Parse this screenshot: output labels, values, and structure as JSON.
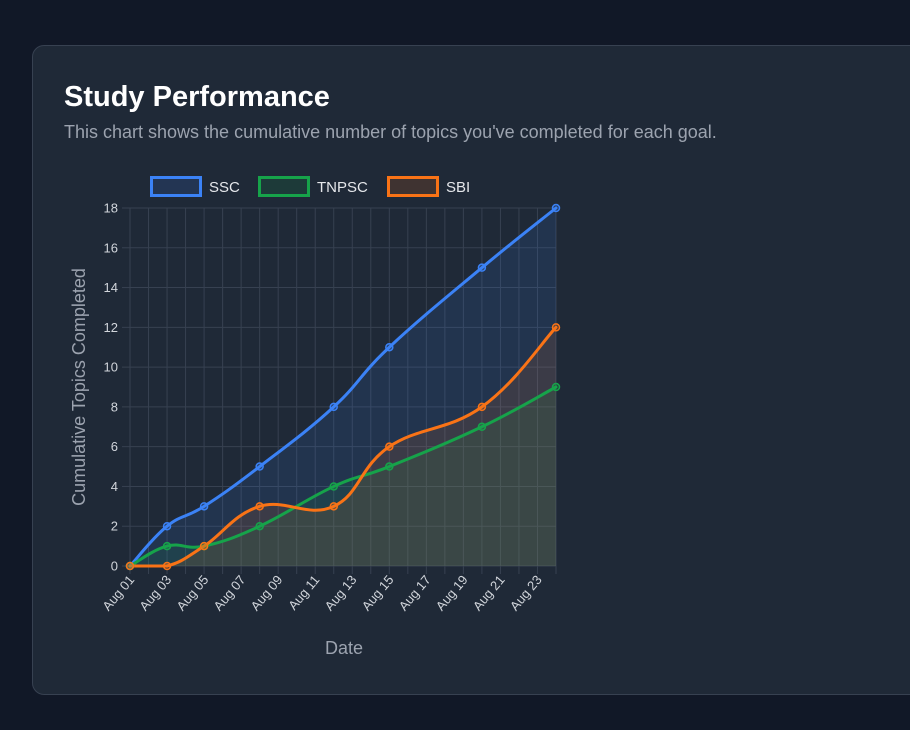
{
  "card": {
    "title": "Study Performance",
    "subtitle": "This chart shows the cumulative number of topics you've completed for each goal."
  },
  "chart_data": {
    "type": "line",
    "xlabel": "Date",
    "ylabel": "Cumulative Topics Completed",
    "x_ticks": [
      "Aug 01",
      "Aug 03",
      "Aug 05",
      "Aug 07",
      "Aug 09",
      "Aug 11",
      "Aug 13",
      "Aug 15",
      "Aug 17",
      "Aug 19",
      "Aug 21",
      "Aug 23"
    ],
    "xlim": [
      "2024-08-01",
      "2024-08-24"
    ],
    "ylim": [
      0,
      18
    ],
    "y_ticks": [
      0,
      2,
      4,
      6,
      8,
      10,
      12,
      14,
      16,
      18
    ],
    "grid": true,
    "legend_position": "top",
    "fill": true,
    "series": [
      {
        "name": "SSC",
        "color": "#3b82f6",
        "points": [
          {
            "x": "2024-08-01",
            "y": 0
          },
          {
            "x": "2024-08-03",
            "y": 2
          },
          {
            "x": "2024-08-05",
            "y": 3
          },
          {
            "x": "2024-08-08",
            "y": 5
          },
          {
            "x": "2024-08-12",
            "y": 8
          },
          {
            "x": "2024-08-15",
            "y": 11
          },
          {
            "x": "2024-08-20",
            "y": 15
          },
          {
            "x": "2024-08-24",
            "y": 18
          }
        ]
      },
      {
        "name": "TNPSC",
        "color": "#16a34a",
        "points": [
          {
            "x": "2024-08-01",
            "y": 0
          },
          {
            "x": "2024-08-03",
            "y": 1
          },
          {
            "x": "2024-08-05",
            "y": 1
          },
          {
            "x": "2024-08-08",
            "y": 2
          },
          {
            "x": "2024-08-12",
            "y": 4
          },
          {
            "x": "2024-08-15",
            "y": 5
          },
          {
            "x": "2024-08-20",
            "y": 7
          },
          {
            "x": "2024-08-24",
            "y": 9
          }
        ]
      },
      {
        "name": "SBI",
        "color": "#f97316",
        "points": [
          {
            "x": "2024-08-01",
            "y": 0
          },
          {
            "x": "2024-08-03",
            "y": 0
          },
          {
            "x": "2024-08-05",
            "y": 1
          },
          {
            "x": "2024-08-08",
            "y": 3
          },
          {
            "x": "2024-08-12",
            "y": 3
          },
          {
            "x": "2024-08-15",
            "y": 6
          },
          {
            "x": "2024-08-20",
            "y": 8
          },
          {
            "x": "2024-08-24",
            "y": 12
          }
        ]
      }
    ]
  }
}
